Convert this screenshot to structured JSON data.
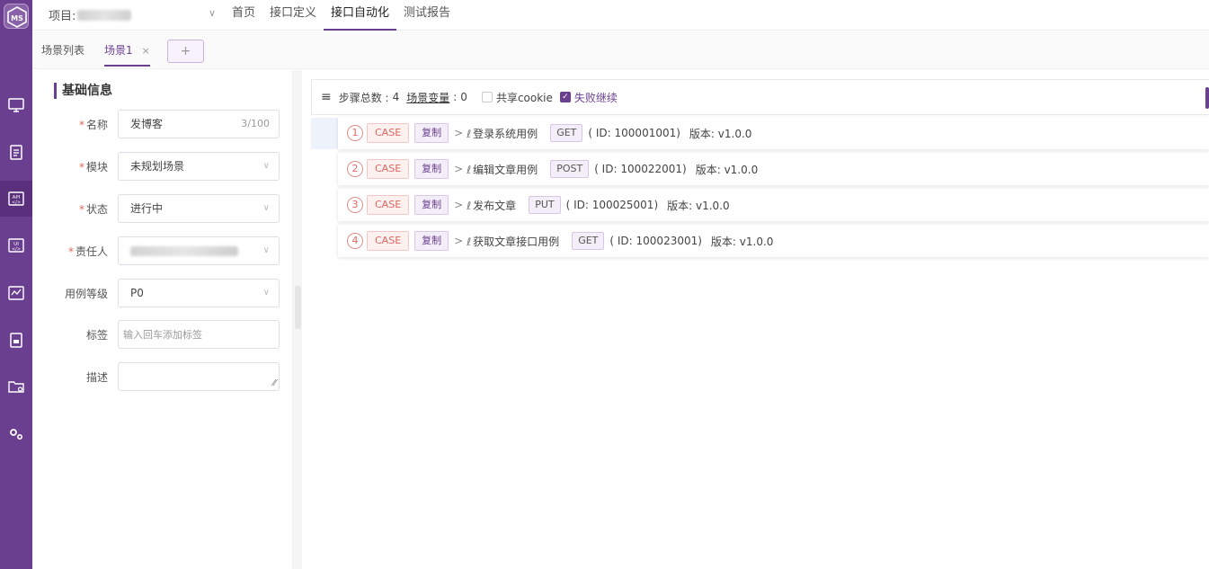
{
  "app": {
    "logo_text": "MS"
  },
  "header": {
    "project_label": "项目: ",
    "nav": [
      "首页",
      "接口定义",
      "接口自动化",
      "测试报告"
    ],
    "active_nav": 2
  },
  "tabs": {
    "list_label": "场景列表",
    "active_label": "场景1",
    "close_symbol": "×",
    "add_symbol": "+"
  },
  "basic_info": {
    "title": "基础信息",
    "name_label": "名称",
    "name_value": "发博客",
    "name_count": "3/100",
    "module_label": "模块",
    "module_value": "未规划场景",
    "status_label": "状态",
    "status_value": "进行中",
    "owner_label": "责任人",
    "level_label": "用例等级",
    "level_value": "P0",
    "tags_label": "标签",
    "tags_placeholder": "输入回车添加标签",
    "desc_label": "描述",
    "required_mark": "*"
  },
  "steps_bar": {
    "total_label": "步骤总数 :",
    "total_value": "4",
    "vars_label": "场景变量",
    "vars_sep": ":",
    "vars_value": "0",
    "share_cookie_label": "共享cookie",
    "continue_on_fail_label": "失败继续"
  },
  "steps": [
    {
      "num": "1",
      "type": "CASE",
      "copy": "复制",
      "name": "登录系统用例",
      "method": "GET",
      "id_text": "( ID: 100001001)",
      "version": "版本: v1.0.0"
    },
    {
      "num": "2",
      "type": "CASE",
      "copy": "复制",
      "name": "编辑文章用例",
      "method": "POST",
      "id_text": "( ID: 100022001)",
      "version": "版本: v1.0.0"
    },
    {
      "num": "3",
      "type": "CASE",
      "copy": "复制",
      "name": "发布文章",
      "method": "PUT",
      "id_text": "( ID: 100025001)",
      "version": "版本: v1.0.0"
    },
    {
      "num": "4",
      "type": "CASE",
      "copy": "复制",
      "name": "获取文章接口用例",
      "method": "GET",
      "id_text": "( ID: 100023001)",
      "version": "版本: v1.0.0"
    }
  ],
  "colors": {
    "brand": "#6b3f8f",
    "case_red": "#e0675f"
  },
  "icons": [
    "monitor-icon",
    "clipboard-icon",
    "api-icon",
    "ui-icon",
    "chart-icon",
    "report-icon",
    "folder-icon",
    "gear-icon"
  ]
}
